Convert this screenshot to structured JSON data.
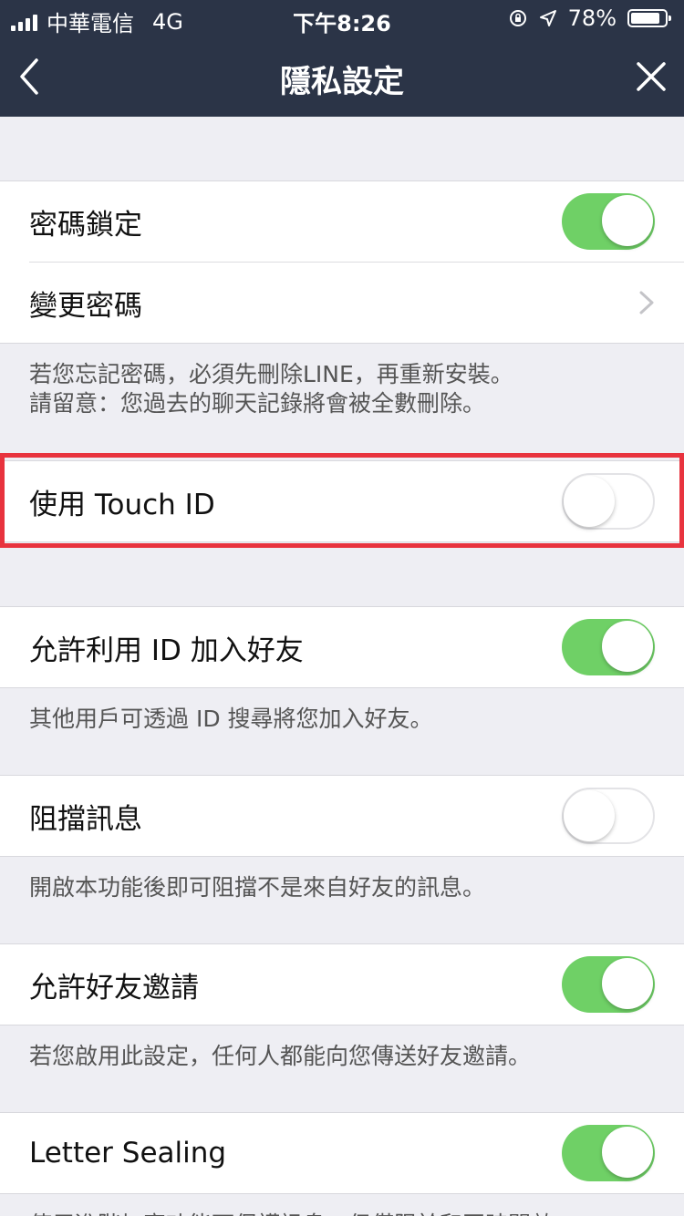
{
  "status_bar": {
    "carrier": "中華電信",
    "network": "4G",
    "time": "下午8:26",
    "battery": "78%",
    "battery_level": 0.78
  },
  "nav": {
    "title": "隱私設定",
    "back_icon": "chevron-left-icon",
    "close_icon": "close-icon"
  },
  "passcode": {
    "lock_label": "密碼鎖定",
    "lock_on": true,
    "change_label": "變更密碼",
    "desc_line1": "若您忘記密碼，必須先刪除LINE，再重新安裝。",
    "desc_line2": "請留意：您過去的聊天記錄將會被全數刪除。"
  },
  "touch_id": {
    "label": "使用 Touch ID",
    "on": false
  },
  "allow_id": {
    "label": "允許利用 ID 加入好友",
    "on": true,
    "desc": "其他用戶可透過 ID 搜尋將您加入好友。"
  },
  "block_messages": {
    "label": "阻擋訊息",
    "on": false,
    "desc": "開啟本功能後即可阻擋不是來自好友的訊息。"
  },
  "allow_invites": {
    "label": "允許好友邀請",
    "on": true,
    "desc": "若您啟用此設定，任何人都能向您傳送好友邀請。"
  },
  "letter_sealing": {
    "label": "Letter Sealing",
    "on": true,
    "desc": "使用進階加密功能可保護訊息，但僅限於和同時開啟L..."
  },
  "colors": {
    "bar_bg": "#2b3447",
    "toggle_on": "#6fd066",
    "highlight": "#e8333e"
  }
}
